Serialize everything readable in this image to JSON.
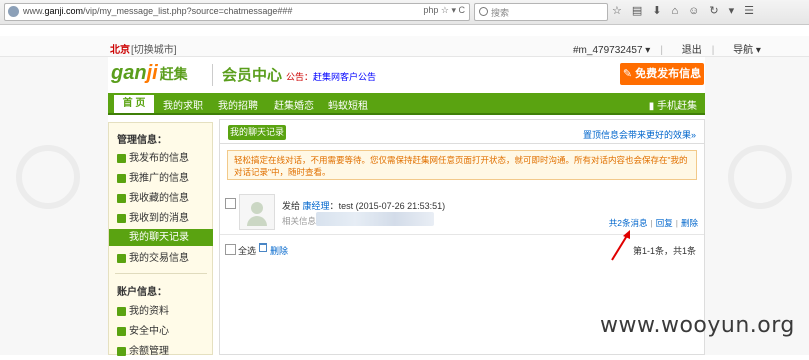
{
  "browser": {
    "url_prefix": "www.",
    "url_domain": "ganji.com",
    "url_path": "/vip/my_message_list.php?source=chatmessage###",
    "url_tools": "php ☆ ▾ C",
    "search_placeholder": "搜索"
  },
  "topbar": {
    "city": "北京",
    "switch_city": "[切换城市]",
    "username": "#m_479732457 ▾",
    "logout": "退出",
    "nav_menu": "导航 ▾"
  },
  "header": {
    "logo_gan": "gan",
    "logo_ji": "ji",
    "logo_cn": "赶集",
    "member_center": "会员中心",
    "notice_label": "公告：",
    "notice_link": "赶集网客户公告",
    "publish_button": "免费发布信息"
  },
  "nav": {
    "home": "首 页",
    "items": [
      "我的求职",
      "我的招聘",
      "赶集婚恋",
      "蚂蚁短租"
    ],
    "mobile": "手机赶集"
  },
  "sidebar": {
    "manage_title": "管理信息：",
    "manage_items": [
      "我发布的信息",
      "我推广的信息",
      "我收藏的信息",
      "我收到的消息",
      "我的聊天记录",
      "我的交易信息"
    ],
    "account_title": "账户信息：",
    "account_items": [
      "我的资料",
      "安全中心",
      "余额管理"
    ]
  },
  "main": {
    "tab_label": "我的聊天记录",
    "tip_link": "置顶信息会带来更好的效果»",
    "warning": "轻松搞定在线对话，不用需要等待。您仅需保持赶集网任意页面打开状态，就可即时沟通。所有对话内容也会保存在\"我的对话记录\"中，随时查看。",
    "message": {
      "send_label": "发给",
      "recipient": "康经理",
      "separator": "：",
      "content": "test",
      "time": "(2015-07-26 21:53:51)",
      "related_label": "相关信息",
      "count_link": "共2条消息",
      "reply": "回复",
      "delete": "删除",
      "pipe": "|"
    },
    "footer": {
      "select_all": "全选",
      "delete_link": "删除",
      "pager": "第1-1条，共1条"
    }
  },
  "watermark": "www.wooyun.org",
  "colors": {
    "brand_green": "#5aa311",
    "publish_orange": "#ff6d00",
    "warning_text": "#e07000",
    "link_blue": "#0066cc"
  }
}
